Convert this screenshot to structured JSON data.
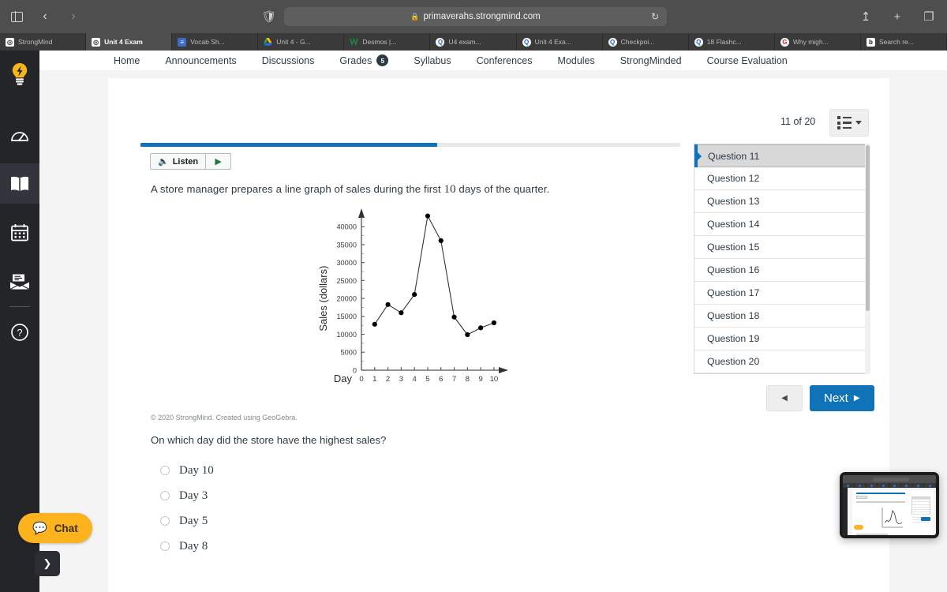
{
  "browser": {
    "url": "primaverahs.strongmind.com",
    "lock_icon": "lock-icon",
    "reload_icon": "reload-icon",
    "back_icon": "back-chevron-icon",
    "forward_icon": "forward-chevron-icon",
    "sidebar_icon": "sidebar-toggle-icon",
    "shield_icon": "shield-icon",
    "share_icon": "share-icon",
    "newtab_icon": "plus-icon",
    "tabs_overview_icon": "tabs-overview-icon",
    "tabs": [
      {
        "label": "StrongMind",
        "favicon": "strongmind-icon",
        "active": false
      },
      {
        "label": "Unit 4 Exam",
        "favicon": "strongmind-icon",
        "active": true
      },
      {
        "label": "Vocab Sh...",
        "favicon": "google-docs-icon",
        "active": false
      },
      {
        "label": "Unit 4 - G...",
        "favicon": "google-drive-icon",
        "active": false
      },
      {
        "label": "Desmos |...",
        "favicon": "desmos-icon",
        "active": false
      },
      {
        "label": "U4 exam...",
        "favicon": "canvas-icon",
        "active": false
      },
      {
        "label": "Unit 4 Exa...",
        "favicon": "canvas-icon",
        "active": false
      },
      {
        "label": "Checkpoi...",
        "favicon": "canvas-icon",
        "active": false
      },
      {
        "label": "18 Flashc...",
        "favicon": "canvas-icon",
        "active": false
      },
      {
        "label": "Why migh...",
        "favicon": "google-icon",
        "active": false
      },
      {
        "label": "Search re...",
        "favicon": "bing-icon",
        "active": false
      }
    ]
  },
  "course_nav": {
    "items": [
      {
        "label": "Home"
      },
      {
        "label": "Announcements"
      },
      {
        "label": "Discussions"
      },
      {
        "label": "Grades",
        "badge": "5"
      },
      {
        "label": "Syllabus"
      },
      {
        "label": "Conferences"
      },
      {
        "label": "Modules"
      },
      {
        "label": "StrongMinded"
      },
      {
        "label": "Course Evaluation"
      }
    ]
  },
  "rail": {
    "items": [
      {
        "name": "lightbulb-icon",
        "selected": false
      },
      {
        "name": "dashboard-gauge-icon",
        "selected": false
      },
      {
        "name": "book-icon",
        "selected": true
      },
      {
        "name": "calendar-icon",
        "selected": false
      },
      {
        "name": "inbox-envelope-icon",
        "selected": false
      },
      {
        "name": "help-circle-icon",
        "selected": false
      }
    ]
  },
  "quiz": {
    "progress_percent": 55,
    "listen_label": "Listen",
    "listen_icon": "speaker-icon",
    "play_icon": "play-icon",
    "stem_before": "A store manager prepares a line graph of sales during the first ",
    "stem_number": "10",
    "stem_after": " days of the quarter.",
    "credit": "© 2020 StrongMind. Created using GeoGebra.",
    "question": "On which day did the store have the highest sales?",
    "options": [
      {
        "label": "Day 10",
        "selected": false
      },
      {
        "label": "Day 3",
        "selected": false
      },
      {
        "label": "Day 5",
        "selected": false
      },
      {
        "label": "Day 8",
        "selected": false
      }
    ]
  },
  "nav_panel": {
    "counter": "11 of 20",
    "list_toggle_icon": "question-list-dropdown-icon",
    "questions": [
      {
        "label": "Question 11",
        "current": true
      },
      {
        "label": "Question 12",
        "current": false
      },
      {
        "label": "Question 13",
        "current": false
      },
      {
        "label": "Question 14",
        "current": false
      },
      {
        "label": "Question 15",
        "current": false
      },
      {
        "label": "Question 16",
        "current": false
      },
      {
        "label": "Question 17",
        "current": false
      },
      {
        "label": "Question 18",
        "current": false
      },
      {
        "label": "Question 19",
        "current": false
      },
      {
        "label": "Question 20",
        "current": false
      }
    ],
    "prev_icon": "left-triangle-icon",
    "next_label": "Next",
    "next_icon": "right-triangle-icon"
  },
  "chat": {
    "label": "Chat",
    "icon": "chat-bubble-icon",
    "flyout_icon": "chevron-right-icon"
  },
  "colors": {
    "accent_blue": "#1073b8",
    "chat_yellow": "#fcb31e",
    "rail_dark": "#242529",
    "chrome_gray": "#4e4e4e"
  },
  "chart_data": {
    "type": "line",
    "title": "",
    "xlabel": "Day",
    "ylabel": "Sales (dollars)",
    "x": [
      1,
      2,
      3,
      4,
      5,
      6,
      7,
      8,
      9,
      10
    ],
    "values": [
      12800,
      18300,
      16000,
      21100,
      43000,
      36100,
      14800,
      9900,
      11800,
      13200
    ],
    "xtick_labels": [
      "0",
      "1",
      "2",
      "3",
      "4",
      "5",
      "6",
      "7",
      "8",
      "9",
      "10"
    ],
    "ytick_labels": [
      "0",
      "5000",
      "10000",
      "15000",
      "20000",
      "25000",
      "30000",
      "35000",
      "40000"
    ],
    "xlim": [
      0,
      10.6
    ],
    "ylim": [
      0,
      44000
    ],
    "grid": false,
    "legend": "none",
    "marker": "filled-circle",
    "line_color": "#333333",
    "marker_color": "#000000"
  }
}
